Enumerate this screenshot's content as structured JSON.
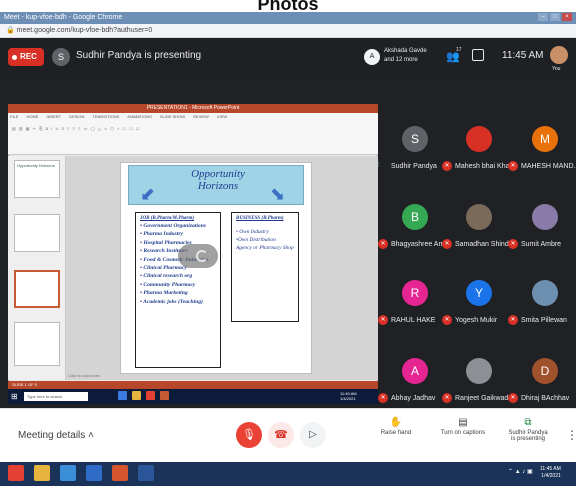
{
  "photo_caption": "Photos",
  "browser": {
    "tab_title": "Meet - kup-vfoe-bdh - Google Chrome",
    "url": "meet.google.com/kup-vfoe-bdh?authuser=0"
  },
  "meet_top": {
    "rec_label": "REC",
    "presenter_initial": "S",
    "presenter_text": "Sudhir Pandya is presenting",
    "akshada_initial": "A",
    "akshada_line1": "Akshada Gavde",
    "akshada_line2": "and 12 more",
    "people_count": "17",
    "time": "11:45 AM",
    "you_label": "You"
  },
  "ppt": {
    "title_bar": "PRESENTATION1 - Microsoft PowerPoint",
    "tabs": [
      "FILE",
      "HOME",
      "INSERT",
      "DESIGN",
      "TRANSITIONS",
      "ANIMATIONS",
      "SLIDE SHOW",
      "REVIEW",
      "VIEW"
    ],
    "thumb1_text": "Opportunity Horizons",
    "click_to_add_notes": "Click to add notes",
    "status_text": "SLIDE 1 OF 5",
    "search_placeholder": "Type here to search",
    "taskbar_time": "11:45 AM",
    "taskbar_date": "1/4/2021"
  },
  "slide": {
    "title_line1": "Opportunity",
    "title_line2": "Horizons",
    "job_heading": "JOB (B.Pharm/M.Pharm)",
    "job_items": [
      "• Government Organizations",
      "• Pharma Industry",
      "• Hospital Pharmacies",
      "• Research Institutes",
      "• Food & Cosmetic Industries",
      "• Clinical Pharmacy",
      "• Clinical research org",
      "• Community Pharmacy",
      "• Pharma Marketing",
      "• Academic jobs (Teaching)"
    ],
    "biz_heading": "BUSINESS (B.Pharm)",
    "biz_items": [
      "• Own Industry",
      "•Own Distribution",
      "Agency or Pharmacy Shop"
    ]
  },
  "tiles": [
    {
      "name": "Sudhir Pandya",
      "initial": "S",
      "color": "#5f6368",
      "kind": "avatar",
      "mic": "on"
    },
    {
      "name": "Mahesh bhai Khara",
      "initial": "",
      "color": "#d93025",
      "kind": "photo",
      "mic": "off"
    },
    {
      "name": "MAHESH MANDALIA",
      "initial": "M",
      "color": "#e8710a",
      "kind": "avatar",
      "mic": "off"
    },
    {
      "name": "Bhagyashree Ambre",
      "initial": "B",
      "color": "#34a853",
      "kind": "avatar",
      "mic": "off"
    },
    {
      "name": "Samadhan Shinde",
      "initial": "",
      "color": "#7b6a5a",
      "kind": "photo",
      "mic": "off"
    },
    {
      "name": "Sumit Ambre",
      "initial": "",
      "color": "#8a7aa8",
      "kind": "photo",
      "mic": "off"
    },
    {
      "name": "RAHUL HAKE",
      "initial": "R",
      "color": "#e52592",
      "kind": "avatar",
      "mic": "off"
    },
    {
      "name": "Yogesh Mukir",
      "initial": "Y",
      "color": "#1a73e8",
      "kind": "avatar",
      "mic": "off"
    },
    {
      "name": "Smita Pillewan",
      "initial": "",
      "color": "#6d8fb0",
      "kind": "photo",
      "mic": "off"
    },
    {
      "name": "Abhay Jadhav",
      "initial": "A",
      "color": "#e52592",
      "kind": "avatar",
      "mic": "off"
    },
    {
      "name": "Ranjeet Gaikwad",
      "initial": "",
      "color": "#8c8f94",
      "kind": "photo",
      "mic": "off"
    },
    {
      "name": "Dhiraj BAchhav",
      "initial": "D",
      "color": "#a0522d",
      "kind": "avatar",
      "mic": "off"
    }
  ],
  "controls": {
    "meeting_details": "Meeting details",
    "raise_hand": "Raise hand",
    "captions": "Turn on captions",
    "presenting_line1": "Sudhir Pandya",
    "presenting_line2": "is presenting"
  },
  "win_taskbar": {
    "time": "11:45 AM",
    "date": "1/4/2021"
  },
  "colors": {
    "meet_bg": "#202124",
    "rec_red": "#d93025",
    "ppt_red": "#b7472a",
    "slide_text": "#1d3b8f",
    "banner_blue": "#9fd3e6"
  }
}
